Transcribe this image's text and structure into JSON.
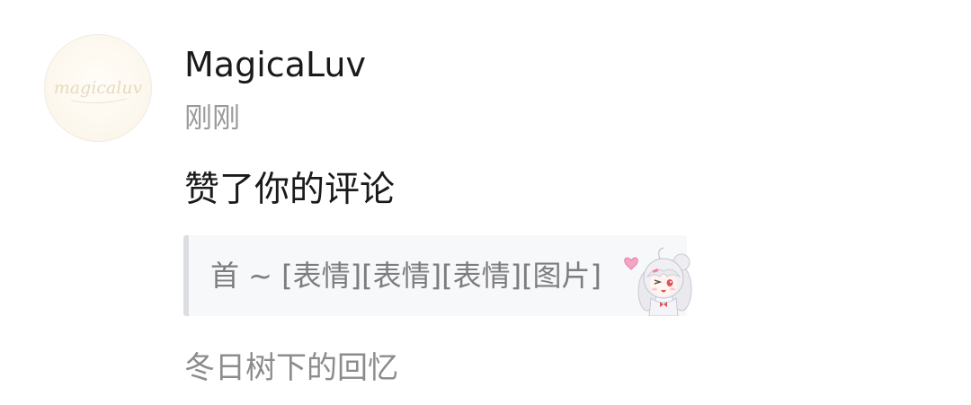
{
  "notification": {
    "avatar_text": "magicaluv",
    "username": "MagicaLuv",
    "timestamp": "刚刚",
    "action": "赞了你的评论",
    "quoted_comment": "首 ~ [表情][表情][表情][图片]",
    "sticker_icon": "anime-girl-sticker-icon",
    "source": "冬日树下的回忆"
  },
  "colors": {
    "primary_text": "#1a1a1a",
    "secondary_text": "#9a9a9a",
    "quote_background": "#f7f8fa",
    "quote_border": "#dcdde0"
  }
}
